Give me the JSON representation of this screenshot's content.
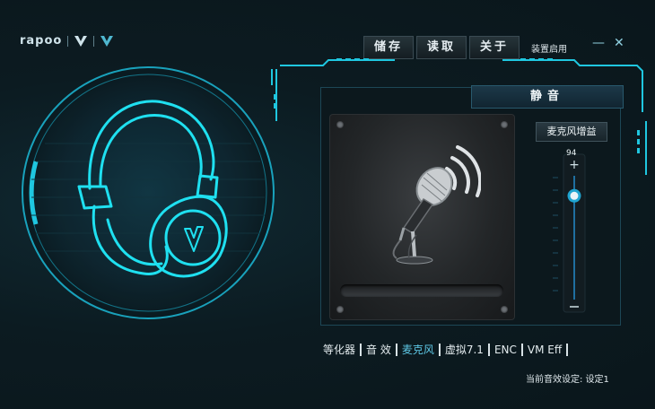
{
  "logo": {
    "brand": "rapoo"
  },
  "toolbar": {
    "save": "储存",
    "read": "读取",
    "about": "关于"
  },
  "device": {
    "label": "装置启用"
  },
  "mic_panel": {
    "mute_label": "静音",
    "gain_label": "麦克风增益",
    "gain_value": "94",
    "gain_max": 100
  },
  "tabs": [
    {
      "label": "等化器"
    },
    {
      "label": "音 效"
    },
    {
      "label": "麦克风"
    },
    {
      "label": "虚拟7.1"
    },
    {
      "label": "ENC"
    },
    {
      "label": "VM Eff"
    }
  ],
  "status": {
    "text": "当前音效设定: 设定1"
  },
  "colors": {
    "accent": "#1fc7e0",
    "active_tab": "#5ec8e6",
    "background": "#0d1a20"
  }
}
